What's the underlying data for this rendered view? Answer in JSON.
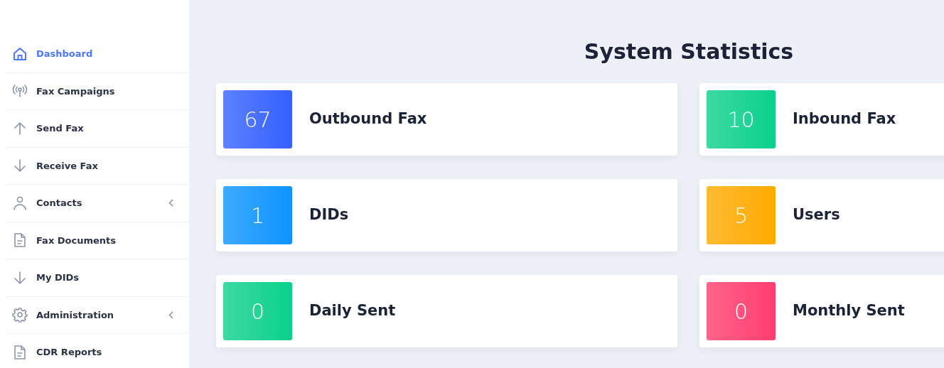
{
  "sidebar": {
    "items": [
      {
        "label": "Dashboard",
        "kind": "home",
        "selected": true,
        "expandable": false
      },
      {
        "label": "Fax Campaigns",
        "kind": "broadcast",
        "selected": false,
        "expandable": false
      },
      {
        "label": "Send Fax",
        "kind": "upload",
        "selected": false,
        "expandable": false
      },
      {
        "label": "Receive Fax",
        "kind": "download",
        "selected": false,
        "expandable": false
      },
      {
        "label": "Contacts",
        "kind": "person",
        "selected": false,
        "expandable": true
      },
      {
        "label": "Fax Documents",
        "kind": "document",
        "selected": false,
        "expandable": false
      },
      {
        "label": "My DIDs",
        "kind": "download",
        "selected": false,
        "expandable": false
      },
      {
        "label": "Administration",
        "kind": "settings",
        "selected": false,
        "expandable": true
      },
      {
        "label": "CDR Reports",
        "kind": "document",
        "selected": false,
        "expandable": false
      }
    ]
  },
  "main": {
    "title": "System Statistics",
    "stat_rows": [
      [
        {
          "count": "67",
          "title": "Outbound Fax",
          "color": "#3461ff"
        },
        {
          "count": "10",
          "title": "Inbound Fax",
          "color": "#0bd18a"
        }
      ],
      [
        {
          "count": "1",
          "title": "DIDs",
          "color": "#0d94ff"
        },
        {
          "count": "5",
          "title": "Users",
          "color": "#ffaa00"
        }
      ],
      [
        {
          "count": "0",
          "title": "Daily Sent",
          "color": "#0bd18a"
        },
        {
          "count": "0",
          "title": "Monthly Sent",
          "color": "#ff3d6e"
        }
      ]
    ]
  }
}
